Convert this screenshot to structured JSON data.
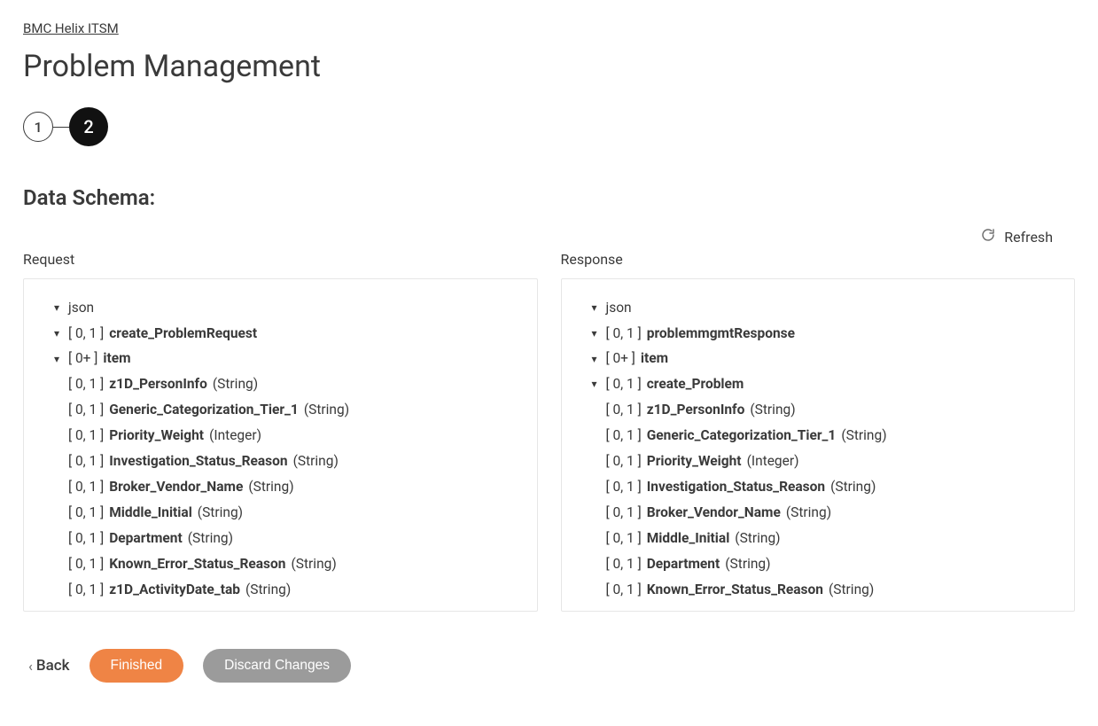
{
  "breadcrumb": "BMC Helix ITSM",
  "page_title": "Problem Management",
  "stepper": {
    "step1": "1",
    "step2": "2"
  },
  "section_title": "Data Schema:",
  "refresh_label": "Refresh",
  "request": {
    "header": "Request",
    "root": "json",
    "node1_card": "[ 0, 1 ]",
    "node1_name": "create_ProblemRequest",
    "node2_card": "[ 0+ ]",
    "node2_name": "item",
    "leaves": [
      {
        "card": "[ 0, 1 ]",
        "name": "z1D_PersonInfo",
        "type": "(String)"
      },
      {
        "card": "[ 0, 1 ]",
        "name": "Generic_Categorization_Tier_1",
        "type": "(String)"
      },
      {
        "card": "[ 0, 1 ]",
        "name": "Priority_Weight",
        "type": "(Integer)"
      },
      {
        "card": "[ 0, 1 ]",
        "name": "Investigation_Status_Reason",
        "type": "(String)"
      },
      {
        "card": "[ 0, 1 ]",
        "name": "Broker_Vendor_Name",
        "type": "(String)"
      },
      {
        "card": "[ 0, 1 ]",
        "name": "Middle_Initial",
        "type": "(String)"
      },
      {
        "card": "[ 0, 1 ]",
        "name": "Department",
        "type": "(String)"
      },
      {
        "card": "[ 0, 1 ]",
        "name": "Known_Error_Status_Reason",
        "type": "(String)"
      },
      {
        "card": "[ 0, 1 ]",
        "name": "z1D_ActivityDate_tab",
        "type": "(String)"
      }
    ]
  },
  "response": {
    "header": "Response",
    "root": "json",
    "node1_card": "[ 0, 1 ]",
    "node1_name": "problemmgmtResponse",
    "node2_card": "[ 0+ ]",
    "node2_name": "item",
    "node3_card": "[ 0, 1 ]",
    "node3_name": "create_Problem",
    "leaves": [
      {
        "card": "[ 0, 1 ]",
        "name": "z1D_PersonInfo",
        "type": "(String)"
      },
      {
        "card": "[ 0, 1 ]",
        "name": "Generic_Categorization_Tier_1",
        "type": "(String)"
      },
      {
        "card": "[ 0, 1 ]",
        "name": "Priority_Weight",
        "type": "(Integer)"
      },
      {
        "card": "[ 0, 1 ]",
        "name": "Investigation_Status_Reason",
        "type": "(String)"
      },
      {
        "card": "[ 0, 1 ]",
        "name": "Broker_Vendor_Name",
        "type": "(String)"
      },
      {
        "card": "[ 0, 1 ]",
        "name": "Middle_Initial",
        "type": "(String)"
      },
      {
        "card": "[ 0, 1 ]",
        "name": "Department",
        "type": "(String)"
      },
      {
        "card": "[ 0, 1 ]",
        "name": "Known_Error_Status_Reason",
        "type": "(String)"
      }
    ]
  },
  "footer": {
    "back": "Back",
    "finished": "Finished",
    "discard": "Discard Changes"
  }
}
